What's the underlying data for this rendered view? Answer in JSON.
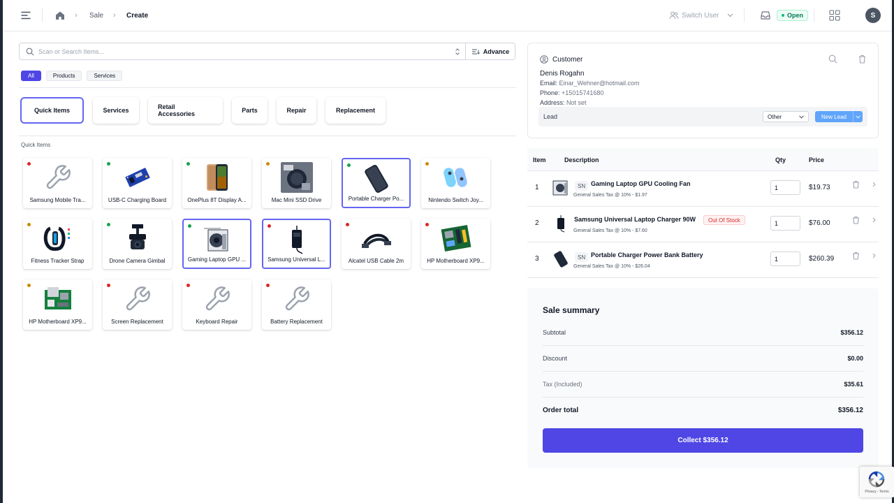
{
  "header": {
    "breadcrumb": [
      "Sale",
      "Create"
    ],
    "switch_user_label": "Switch User",
    "register_status": "Open",
    "avatar_initial": "S"
  },
  "search": {
    "placeholder": "Scan or Search Items...",
    "advance_label": "Advance"
  },
  "filters": [
    {
      "label": "All",
      "active": true
    },
    {
      "label": "Products",
      "active": false
    },
    {
      "label": "Services",
      "active": false
    }
  ],
  "categories": [
    {
      "label": "Quick Items",
      "active": true
    },
    {
      "label": "Services",
      "active": false
    },
    {
      "label": "Retail Accessories",
      "active": false
    },
    {
      "label": "Parts",
      "active": false
    },
    {
      "label": "Repair",
      "active": false
    },
    {
      "label": "Replacement",
      "active": false
    }
  ],
  "section_label": "Quick Items",
  "items": [
    {
      "name": "Samsung Mobile Tra...",
      "status_color": "#dc2626",
      "icon": "wrench-icon",
      "selected": false
    },
    {
      "name": "USB-C Charging Board",
      "status_color": "#16a34a",
      "icon": "circuit-board-icon",
      "selected": false
    },
    {
      "name": "OnePlus 8T Display A...",
      "status_color": "#16a34a",
      "icon": "phone-display-icon",
      "selected": false
    },
    {
      "name": "Mac Mini SSD Drive",
      "status_color": "#ca8a04",
      "icon": "ssd-drive-icon",
      "selected": false
    },
    {
      "name": "Portable Charger Po...",
      "status_color": "#16a34a",
      "icon": "power-bank-icon",
      "selected": true
    },
    {
      "name": "Nintendo Switch Joy...",
      "status_color": "#ca8a04",
      "icon": "joycon-icon",
      "selected": false
    },
    {
      "name": "Fitness Tracker Strap",
      "status_color": "#ca8a04",
      "icon": "fitness-band-icon",
      "selected": false
    },
    {
      "name": "Drone Camera Gimbal",
      "status_color": "#16a34a",
      "icon": "gimbal-icon",
      "selected": false
    },
    {
      "name": "Gaming Laptop GPU ...",
      "status_color": "#16a34a",
      "icon": "gpu-fan-icon",
      "selected": true
    },
    {
      "name": "Samsung Universal L...",
      "status_color": "#dc2626",
      "icon": "laptop-charger-icon",
      "selected": true
    },
    {
      "name": "Alcatel USB Cable 2m",
      "status_color": "#dc2626",
      "icon": "usb-cable-icon",
      "selected": false
    },
    {
      "name": "HP Motherboard XP9...",
      "status_color": "#dc2626",
      "icon": "motherboard-icon",
      "selected": false
    },
    {
      "name": "HP Motherboard XP9...",
      "status_color": "#ca8a04",
      "icon": "motherboard-icon",
      "selected": false
    },
    {
      "name": "Screen Replacement",
      "status_color": "#dc2626",
      "icon": "wrench-icon",
      "selected": false
    },
    {
      "name": "Keyboard Repair",
      "status_color": "#dc2626",
      "icon": "wrench-icon",
      "selected": false
    },
    {
      "name": "Battery Replacement",
      "status_color": "#dc2626",
      "icon": "wrench-icon",
      "selected": false
    }
  ],
  "customer": {
    "title": "Customer",
    "name": "Denis Rogahn",
    "email_label": "Email:",
    "email": "Einar_Wehner@hotmail.com",
    "phone_label": "Phone:",
    "phone": "+15015741680",
    "address_label": "Address:",
    "address": "Not set",
    "lead_label": "Lead",
    "lead_value": "Other",
    "new_lead_label": "New Lead"
  },
  "cart": {
    "headers": {
      "item": "Item",
      "description": "Description",
      "qty": "Qty",
      "price": "Price"
    },
    "rows": [
      {
        "index": "1",
        "sn": "SN",
        "name": "Gaming Laptop GPU Cooling Fan",
        "tax": "General Sales Tax @ 10% - $1.97",
        "qty": "1",
        "price": "$19.73",
        "badge": ""
      },
      {
        "index": "2",
        "sn": "",
        "name": "Samsung Universal Laptop Charger 90W",
        "tax": "General Sales Tax @ 10% - $7.60",
        "qty": "1",
        "price": "$76.00",
        "badge": "Out Of Stock"
      },
      {
        "index": "3",
        "sn": "SN",
        "name": "Portable Charger Power Bank Battery",
        "tax": "General Sales Tax @ 10% - $26.04",
        "qty": "1",
        "price": "$260.39",
        "badge": ""
      }
    ]
  },
  "summary": {
    "title": "Sale summary",
    "subtotal_label": "Subtotal",
    "subtotal": "$356.12",
    "discount_label": "Discount",
    "discount": "$0.00",
    "tax_label": "Tax",
    "tax_note": "(Included)",
    "tax": "$35.61",
    "total_label": "Order total",
    "total": "$356.12",
    "collect_label": "Collect $356.12"
  },
  "recaptcha_text": "Privacy - Terms",
  "colors": {
    "accent": "#4f46e5",
    "selected_border": "#6366f1",
    "open_green": "#10b981",
    "new_lead_blue": "#60a5fa"
  }
}
